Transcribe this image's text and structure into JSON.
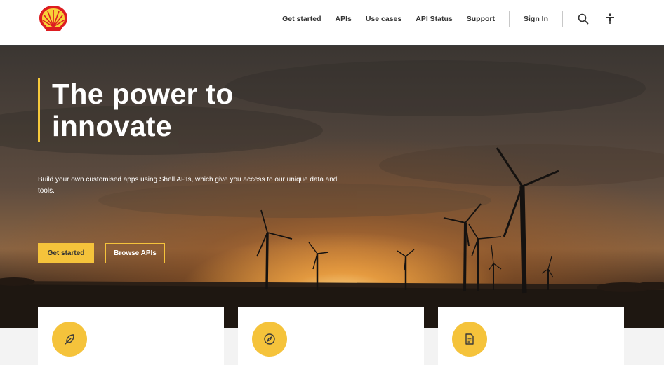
{
  "header": {
    "logo_icon": "shell-pecten-logo",
    "nav": [
      "Get started",
      "APIs",
      "Use cases",
      "API Status",
      "Support"
    ],
    "sign_in": "Sign In",
    "search_icon": "search-icon",
    "accessibility_icon": "accessibility-icon"
  },
  "hero": {
    "title_line1": "The power to",
    "title_line2": "innovate",
    "subtitle": "Build your own customised apps using Shell APIs, which give you access to our unique data and tools.",
    "primary_button": "Get started",
    "secondary_button": "Browse APIs",
    "accent_color": "#f5c33b"
  },
  "cards": [
    {
      "icon": "feather-icon"
    },
    {
      "icon": "compass-icon"
    },
    {
      "icon": "document-icon"
    }
  ]
}
